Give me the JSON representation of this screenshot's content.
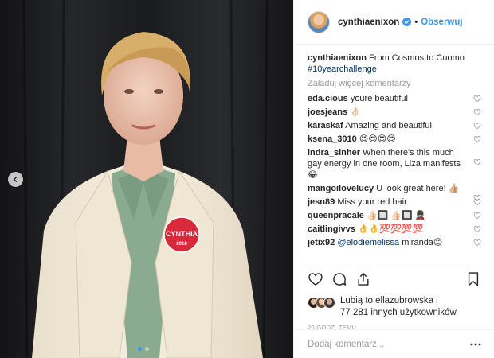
{
  "post": {
    "author": "cynthiaenixon",
    "follow_label": "Obserwuj",
    "separator": "•",
    "caption_user": "cynthiaenixon",
    "caption_text": "From Cosmos to Cuomo",
    "caption_hashtag": "#10yearchallenge",
    "load_more": "Załaduj więcej komentarzy",
    "badge_text": "CYNTHIA",
    "badge_sub": "2018"
  },
  "comments": [
    {
      "user": "eda.cious",
      "text": "youre beautiful"
    },
    {
      "user": "joesjeans",
      "text": "👌🏻"
    },
    {
      "user": "karaskaf",
      "text": "Amazing and beautiful!"
    },
    {
      "user": "ksena_3010",
      "text": "😍😍😍😍"
    },
    {
      "user": "indra_sinher",
      "text": "When there's this much gay energy in one room, Liza manifests 😂"
    },
    {
      "user": "mangoilovelucy",
      "text": "U look great here! 👍🏼"
    },
    {
      "user": "jesn89",
      "text": "Miss your red hair"
    },
    {
      "user": "queenpracale",
      "text": "👍🏻🔲 👍🏻🔲 💂🏻"
    },
    {
      "user": "caitlingivvs",
      "text": "👌👌💯💯💯💯"
    },
    {
      "user": "jetix92",
      "mention": "@elodiemelissa",
      "text": "miranda😊"
    }
  ],
  "likes": {
    "line1": "Lubią to ellazubrowska i",
    "line2": "77 281 innych użytkowników"
  },
  "timestamp": "20 GODZ. TEMU",
  "add_comment_placeholder": "Dodaj komentarz...",
  "icons": {
    "verified": "verified-badge-icon",
    "heart": "heart-icon",
    "comment": "comment-icon",
    "share": "share-icon",
    "save": "bookmark-icon",
    "more": "more-options-icon",
    "prev": "chevron-left-icon"
  },
  "colors": {
    "accent": "#3897f0",
    "text": "#262626",
    "muted": "#999999",
    "border": "#efefef",
    "hashtag": "#003569"
  },
  "carousel": {
    "total": 2,
    "active": 1
  }
}
